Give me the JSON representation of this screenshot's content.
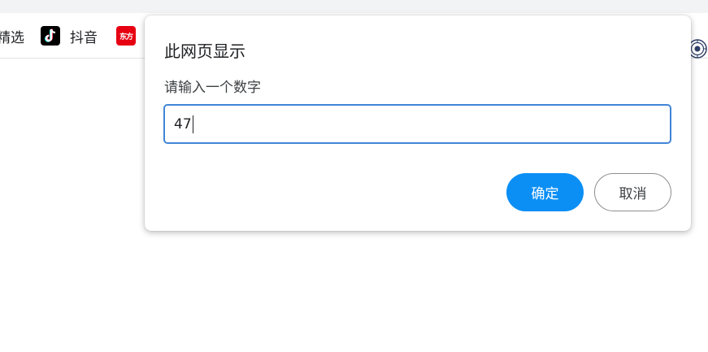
{
  "bookmarks": {
    "items": [
      {
        "label": "精选"
      },
      {
        "label": "抖音",
        "icon": "tiktok-icon"
      },
      {
        "label": "",
        "icon_text": "东方",
        "icon": "dongfang-icon"
      }
    ]
  },
  "dialog": {
    "title": "此网页显示",
    "message": "请输入一个数字",
    "input_value": "47",
    "ok_label": "确定",
    "cancel_label": "取消"
  },
  "colors": {
    "ok_button": "#0b8ff5",
    "input_border": "#4285d6",
    "tiktok_bg": "#000000",
    "dongfang_bg": "#e60012"
  }
}
